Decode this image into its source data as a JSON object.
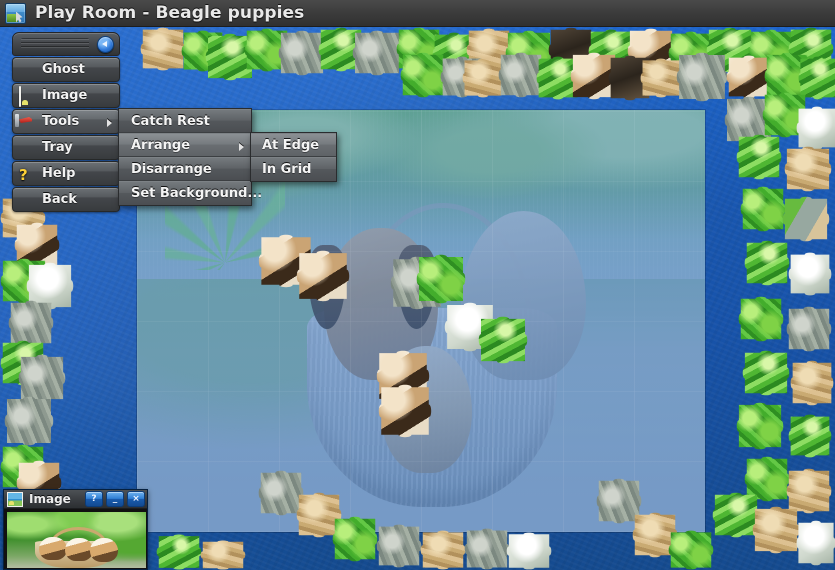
{
  "window": {
    "title": "Play Room - Beagle puppies",
    "app_icon": "puzzle-game-icon"
  },
  "menu": {
    "collapse_icon": "collapse-left-arrow-icon",
    "items": [
      {
        "label": "Ghost",
        "icon": "ghost-icon",
        "has_submenu": false,
        "active": false
      },
      {
        "label": "Image",
        "icon": "image-icon",
        "has_submenu": false,
        "active": false
      },
      {
        "label": "Tools",
        "icon": "tools-icon",
        "has_submenu": true,
        "active": true
      },
      {
        "label": "Tray",
        "icon": "tray-icon",
        "has_submenu": false,
        "active": false
      },
      {
        "label": "Help",
        "icon": "help-icon",
        "has_submenu": false,
        "active": false
      },
      {
        "label": "Back",
        "icon": "back-arrow-icon",
        "has_submenu": false,
        "active": false
      }
    ]
  },
  "tools_submenu": {
    "items": [
      {
        "label": "Catch Rest",
        "has_submenu": false,
        "hover": false
      },
      {
        "label": "Arrange",
        "has_submenu": true,
        "hover": true
      },
      {
        "label": "Disarrange",
        "has_submenu": false,
        "hover": false
      },
      {
        "label": "Set Background...",
        "has_submenu": false,
        "hover": false
      }
    ]
  },
  "arrange_submenu": {
    "items": [
      {
        "label": "At Edge",
        "hover": true
      },
      {
        "label": "In Grid",
        "hover": false
      }
    ]
  },
  "image_panel": {
    "title": "Image",
    "icon": "image-icon",
    "buttons": [
      {
        "label": "?",
        "name": "help-button"
      },
      {
        "label": "_",
        "name": "minimize-button"
      },
      {
        "label": "×",
        "label_alt": "x",
        "name": "close-button"
      }
    ],
    "preview_alt": "Beagle puppies in a basket"
  },
  "colors": {
    "board_blue": "#1a5cbd",
    "titlebar_dark": "#3d3d3d",
    "menu_gray": "#55595d",
    "submenu_gray": "#5e6266",
    "accent_blue": "#2f78d8",
    "icon_yellow": "#fcd037",
    "text_light": "#f2f2f2"
  },
  "puzzle": {
    "ghost_overlay_visible": true,
    "pieces_arranged": "at-edge"
  }
}
